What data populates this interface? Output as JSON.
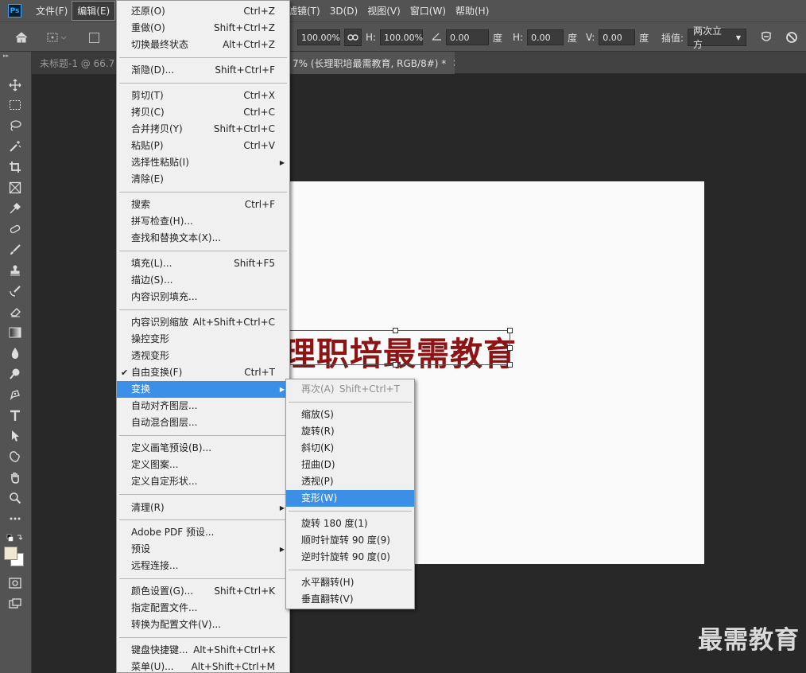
{
  "app": {
    "logo": "Ps"
  },
  "menubar": {
    "items": [
      "文件(F)",
      "编辑(E)"
    ],
    "right_items": [
      "滤镜(T)",
      "3D(D)",
      "视图(V)",
      "窗口(W)",
      "帮助(H)"
    ]
  },
  "options": {
    "w_value": "100.00%",
    "h_label": "H:",
    "h_value": "100.00%",
    "angle_value": "0.00",
    "angle_unit": "度",
    "hskew_label": "H:",
    "hskew_value": "0.00",
    "hskew_unit": "度",
    "vskew_label": "V:",
    "vskew_value": "0.00",
    "vskew_unit": "度",
    "interp_label": "插值:",
    "interp_value": "两次立方"
  },
  "tabs": {
    "inactive_label": "未标题-1 @ 66.7",
    "active_label": "7% (长理职培最需教育, RGB/8#) *",
    "close": "×"
  },
  "canvas": {
    "text": "理职培最需教育",
    "text_color": "#8c1414"
  },
  "watermark": "最需教育",
  "edit_menu": {
    "undo": {
      "label": "还原(O)",
      "shortcut": "Ctrl+Z"
    },
    "redo": {
      "label": "重做(O)",
      "shortcut": "Shift+Ctrl+Z"
    },
    "toggle_last": {
      "label": "切换最终状态",
      "shortcut": "Alt+Ctrl+Z"
    },
    "fade": {
      "label": "渐隐(D)...",
      "shortcut": "Shift+Ctrl+F"
    },
    "cut": {
      "label": "剪切(T)",
      "shortcut": "Ctrl+X"
    },
    "copy": {
      "label": "拷贝(C)",
      "shortcut": "Ctrl+C"
    },
    "copy_merged": {
      "label": "合并拷贝(Y)",
      "shortcut": "Shift+Ctrl+C"
    },
    "paste": {
      "label": "粘贴(P)",
      "shortcut": "Ctrl+V"
    },
    "paste_special": {
      "label": "选择性粘贴(I)"
    },
    "clear": {
      "label": "清除(E)"
    },
    "search": {
      "label": "搜索",
      "shortcut": "Ctrl+F"
    },
    "spell_check": {
      "label": "拼写检查(H)..."
    },
    "find_replace": {
      "label": "查找和替换文本(X)..."
    },
    "fill": {
      "label": "填充(L)...",
      "shortcut": "Shift+F5"
    },
    "stroke": {
      "label": "描边(S)..."
    },
    "content_aware_fill": {
      "label": "内容识别填充..."
    },
    "content_aware_scale": {
      "label": "内容识别缩放",
      "shortcut": "Alt+Shift+Ctrl+C"
    },
    "puppet_warp": {
      "label": "操控变形"
    },
    "perspective_warp": {
      "label": "透视变形"
    },
    "free_transform": {
      "label": "自由变换(F)",
      "shortcut": "Ctrl+T",
      "check": "✔"
    },
    "transform": {
      "label": "变换"
    },
    "auto_align": {
      "label": "自动对齐图层..."
    },
    "auto_blend": {
      "label": "自动混合图层..."
    },
    "define_brush": {
      "label": "定义画笔预设(B)..."
    },
    "define_pattern": {
      "label": "定义图案..."
    },
    "define_shape": {
      "label": "定义自定形状..."
    },
    "purge": {
      "label": "清理(R)"
    },
    "pdf_presets": {
      "label": "Adobe PDF 预设..."
    },
    "presets": {
      "label": "预设"
    },
    "remote": {
      "label": "远程连接..."
    },
    "color_settings": {
      "label": "颜色设置(G)...",
      "shortcut": "Shift+Ctrl+K"
    },
    "assign_profile": {
      "label": "指定配置文件..."
    },
    "convert_profile": {
      "label": "转换为配置文件(V)..."
    },
    "keyboard_shortcuts": {
      "label": "键盘快捷键...",
      "shortcut": "Alt+Shift+Ctrl+K"
    },
    "menus": {
      "label": "菜单(U)...",
      "shortcut": "Alt+Shift+Ctrl+M"
    }
  },
  "transform_menu": {
    "again": {
      "label": "再次(A)",
      "shortcut": "Shift+Ctrl+T"
    },
    "scale": {
      "label": "缩放(S)"
    },
    "rotate": {
      "label": "旋转(R)"
    },
    "skew": {
      "label": "斜切(K)"
    },
    "distort": {
      "label": "扭曲(D)"
    },
    "perspective": {
      "label": "透视(P)"
    },
    "warp": {
      "label": "变形(W)"
    },
    "rotate180": {
      "label": "旋转 180 度(1)"
    },
    "rotate90cw": {
      "label": "顺时针旋转 90 度(9)"
    },
    "rotate90ccw": {
      "label": "逆时针旋转 90 度(0)"
    },
    "flip_h": {
      "label": "水平翻转(H)"
    },
    "flip_v": {
      "label": "垂直翻转(V)"
    }
  },
  "colors": {
    "menu_highlight": "#3c8fe6",
    "accent": "#31a8ff"
  }
}
